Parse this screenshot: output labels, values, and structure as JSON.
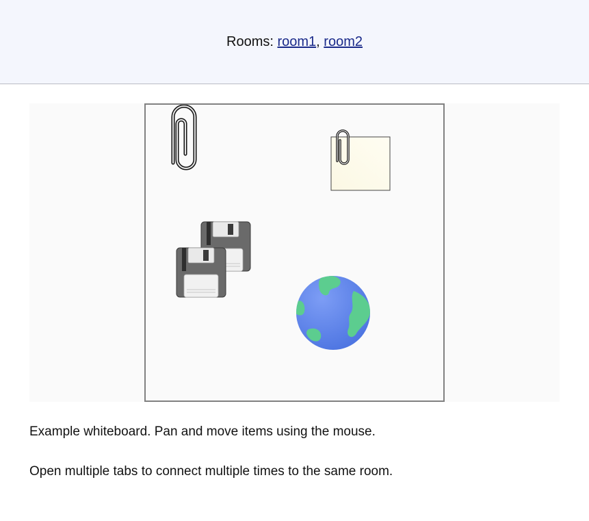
{
  "header": {
    "rooms_prefix": "Rooms:",
    "separator": ",",
    "rooms": [
      {
        "label": "room1"
      },
      {
        "label": "room2"
      }
    ]
  },
  "whiteboard": {
    "items": [
      {
        "name": "paperclip",
        "icon": "paperclip-icon"
      },
      {
        "name": "sticky-note",
        "icon": "sticky-note-icon"
      },
      {
        "name": "floppy-disk-back",
        "icon": "floppy-disk-icon"
      },
      {
        "name": "floppy-disk-front",
        "icon": "floppy-disk-icon"
      },
      {
        "name": "globe",
        "icon": "globe-icon"
      }
    ]
  },
  "captions": {
    "line1": "Example whiteboard. Pan and move items using the mouse.",
    "line2": "Open multiple tabs to connect multiple times to the same room."
  },
  "colors": {
    "header_bg": "#f4f6fd",
    "link": "#1a2a8a",
    "board_border": "#808080",
    "globe_ocean": "#5b86ee",
    "globe_land": "#5ccd8f"
  }
}
